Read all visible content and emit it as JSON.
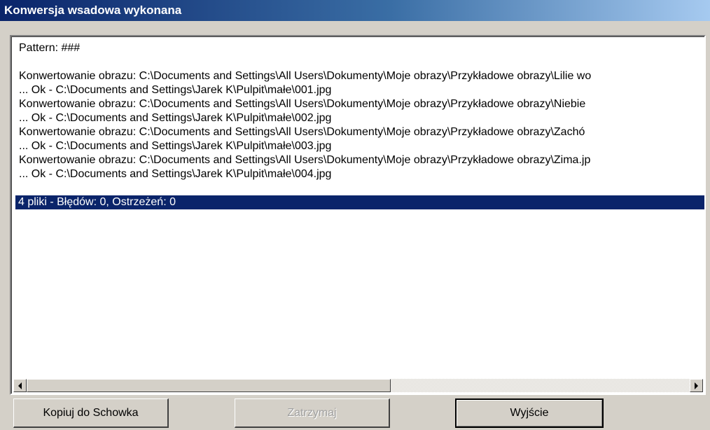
{
  "window": {
    "title": "Konwersja wsadowa wykonana"
  },
  "log": {
    "lines": [
      "Pattern: ###",
      "",
      "Konwertowanie obrazu: C:\\Documents and Settings\\All Users\\Dokumenty\\Moje obrazy\\Przykładowe obrazy\\Lilie wo",
      "... Ok - C:\\Documents and Settings\\Jarek K\\Pulpit\\małe\\001.jpg",
      "Konwertowanie obrazu: C:\\Documents and Settings\\All Users\\Dokumenty\\Moje obrazy\\Przykładowe obrazy\\Niebie",
      "... Ok - C:\\Documents and Settings\\Jarek K\\Pulpit\\małe\\002.jpg",
      "Konwertowanie obrazu: C:\\Documents and Settings\\All Users\\Dokumenty\\Moje obrazy\\Przykładowe obrazy\\Zachó",
      "... Ok - C:\\Documents and Settings\\Jarek K\\Pulpit\\małe\\003.jpg",
      "Konwertowanie obrazu: C:\\Documents and Settings\\All Users\\Dokumenty\\Moje obrazy\\Przykładowe obrazy\\Zima.jp",
      "... Ok - C:\\Documents and Settings\\Jarek K\\Pulpit\\małe\\004.jpg",
      "",
      "4 pliki - Błędów: 0, Ostrzeżeń: 0"
    ],
    "selected_line": "4 pliki - Błędów: 0, Ostrzeżeń: 0"
  },
  "scrollbar": {
    "left_arrow_icon": "arrow-left-icon",
    "right_arrow_icon": "arrow-right-icon",
    "position": 0
  },
  "buttons": {
    "copy_label": "Kopiuj do Schowka",
    "stop_label": "Zatrzymaj",
    "exit_label": "Wyjście"
  },
  "colors": {
    "title_bar_start": "#0a246a",
    "title_bar_end": "#a6caf0",
    "selection": "#0a246a",
    "face": "#d4d0c8"
  }
}
